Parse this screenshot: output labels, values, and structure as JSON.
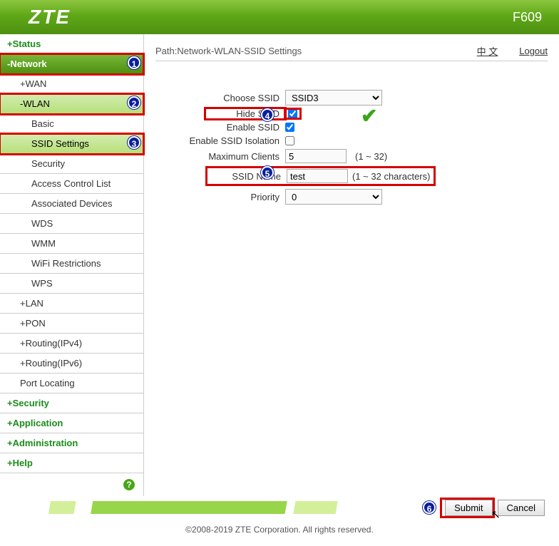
{
  "header": {
    "logo": "ZTE",
    "model": "F609"
  },
  "topbar": {
    "path": "Path:Network-WLAN-SSID Settings",
    "lang_link": "中 文",
    "logout": "Logout"
  },
  "sidebar": [
    {
      "label": "+Status",
      "cls": "top"
    },
    {
      "label": "-Network",
      "cls": "active-top",
      "callout": 1,
      "hl": true
    },
    {
      "label": "+WAN",
      "cls": "sub1"
    },
    {
      "label": "-WLAN",
      "cls": "sub1 active-sub",
      "callout": 2,
      "hl": true
    },
    {
      "label": "Basic",
      "cls": "sub2"
    },
    {
      "label": "SSID Settings",
      "cls": "sub2 active-sub",
      "callout": 3,
      "hl": true
    },
    {
      "label": "Security",
      "cls": "sub2"
    },
    {
      "label": "Access Control List",
      "cls": "sub2"
    },
    {
      "label": "Associated Devices",
      "cls": "sub2"
    },
    {
      "label": "WDS",
      "cls": "sub2"
    },
    {
      "label": "WMM",
      "cls": "sub2"
    },
    {
      "label": "WiFi Restrictions",
      "cls": "sub2"
    },
    {
      "label": "WPS",
      "cls": "sub2"
    },
    {
      "label": "+LAN",
      "cls": "sub1"
    },
    {
      "label": "+PON",
      "cls": "sub1"
    },
    {
      "label": "+Routing(IPv4)",
      "cls": "sub1"
    },
    {
      "label": "+Routing(IPv6)",
      "cls": "sub1"
    },
    {
      "label": "Port Locating",
      "cls": "sub1"
    },
    {
      "label": "+Security",
      "cls": "top"
    },
    {
      "label": "+Application",
      "cls": "top"
    },
    {
      "label": "+Administration",
      "cls": "top"
    },
    {
      "label": "+Help",
      "cls": "top"
    }
  ],
  "form": {
    "choose_ssid_label": "Choose SSID",
    "choose_ssid_value": "SSID3",
    "hide_ssid_label": "Hide SSID",
    "hide_ssid_checked": true,
    "enable_ssid_label": "Enable SSID",
    "enable_ssid_checked": true,
    "isolation_label": "Enable SSID Isolation",
    "isolation_checked": false,
    "max_clients_label": "Maximum Clients",
    "max_clients_value": "5",
    "max_clients_hint": "(1 ~ 32)",
    "ssid_name_label": "SSID Name",
    "ssid_name_value": "test",
    "ssid_name_hint": "(1 ~ 32 characters)",
    "priority_label": "Priority",
    "priority_value": "0"
  },
  "buttons": {
    "submit": "Submit",
    "cancel": "Cancel"
  },
  "copyright": "©2008-2019 ZTE Corporation. All rights reserved."
}
